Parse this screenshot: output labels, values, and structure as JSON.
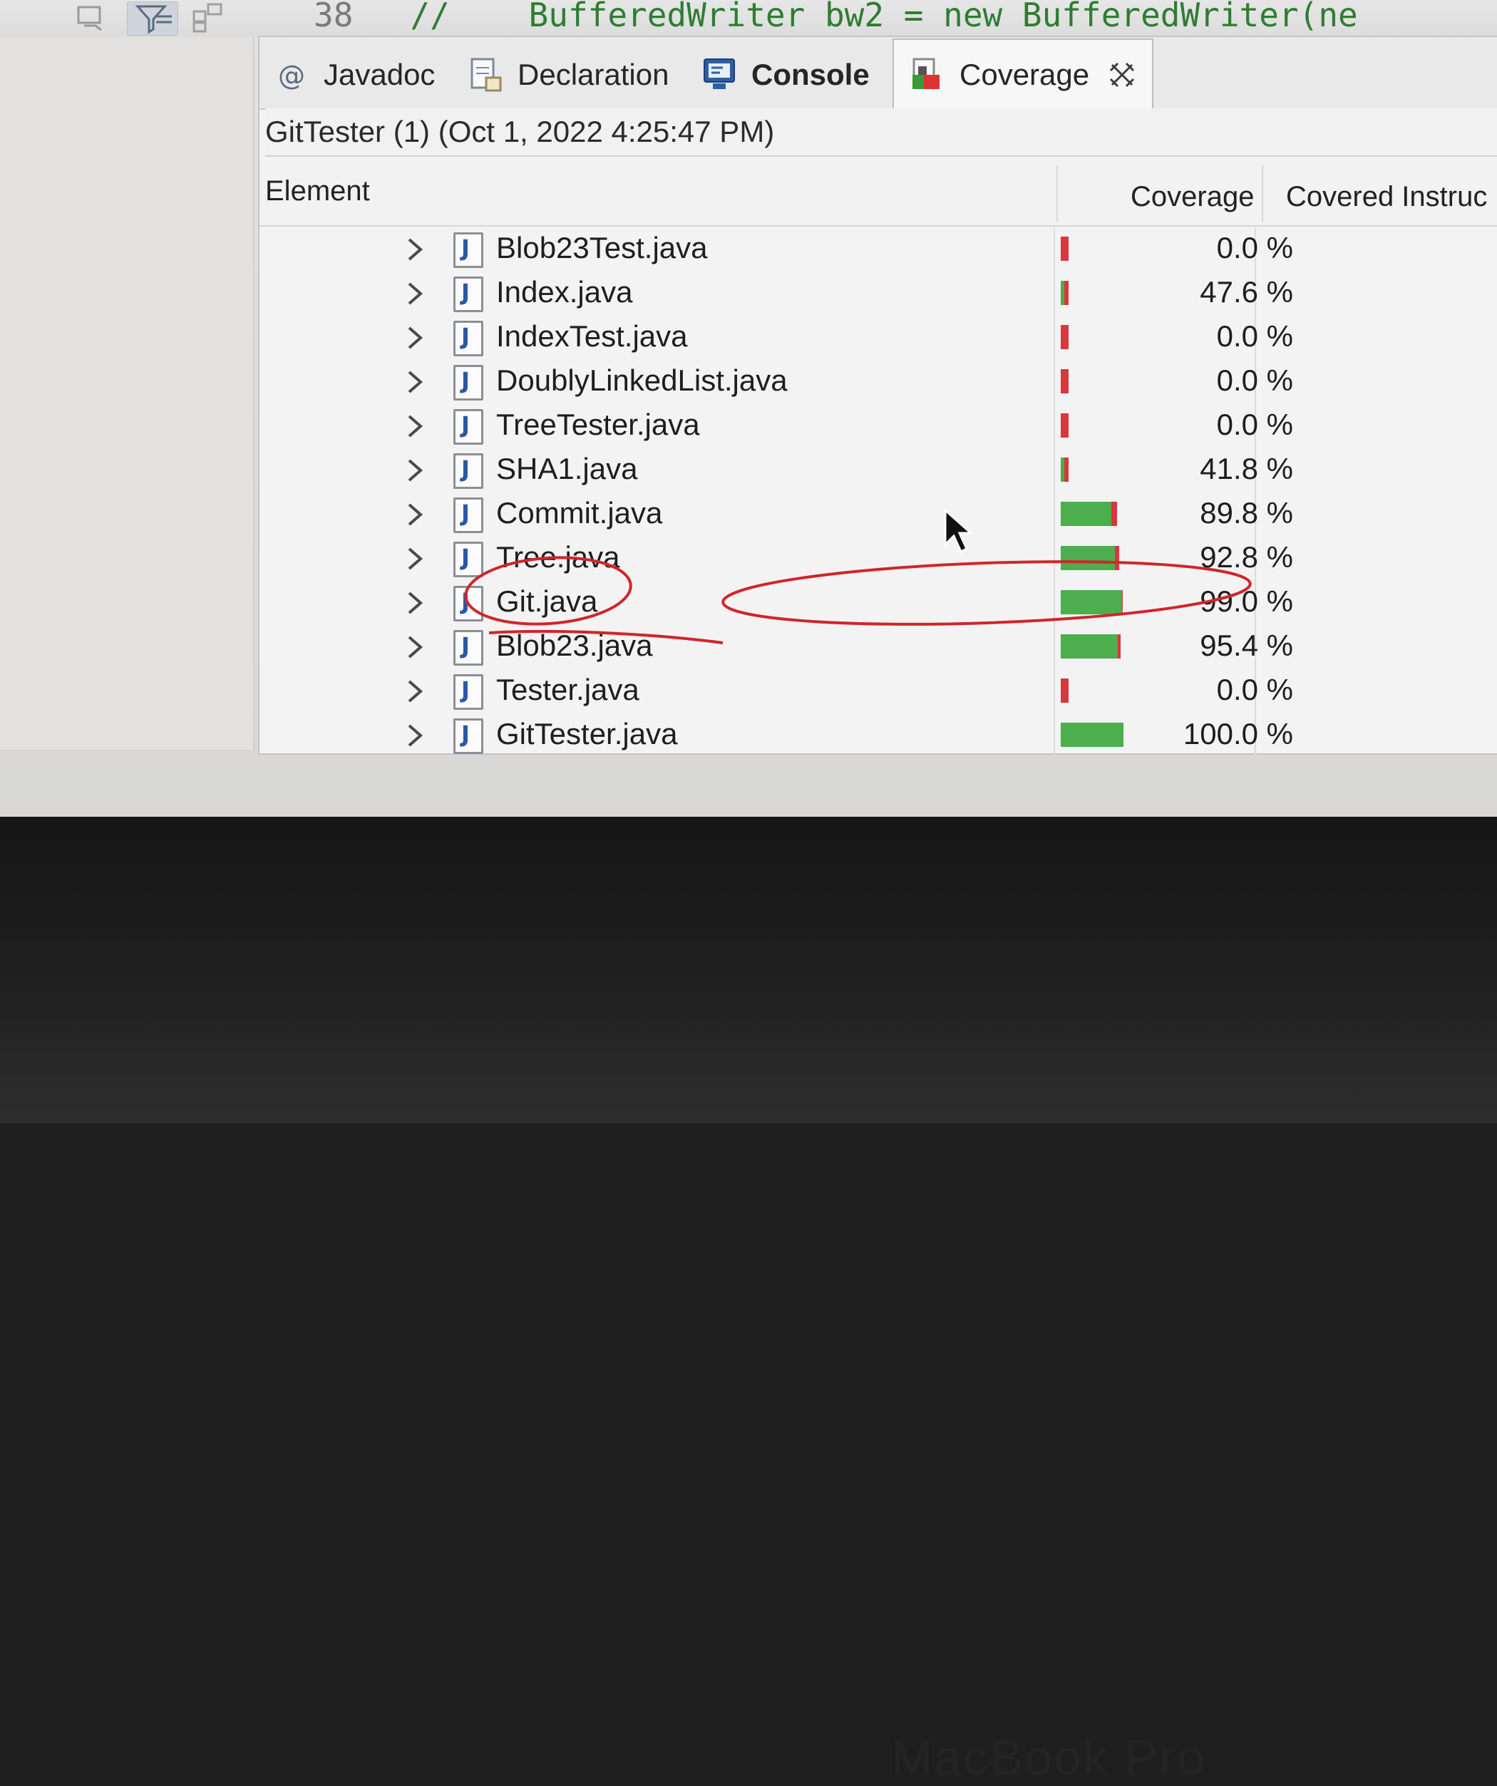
{
  "toolbar": {
    "line_number": "38",
    "code_text": "  //    BufferedWriter bw2 = new BufferedWriter(ne"
  },
  "tabs": [
    {
      "label": "Javadoc",
      "icon": "at-icon"
    },
    {
      "label": "Declaration",
      "icon": "declaration-icon"
    },
    {
      "label": "Console",
      "icon": "console-icon"
    },
    {
      "label": "Coverage",
      "icon": "coverage-icon",
      "close_icon": "close-icon"
    }
  ],
  "session_title": "GitTester (1) (Oct 1, 2022 4:25:47 PM)",
  "table": {
    "columns": [
      "Element",
      "Coverage",
      "Covered Instruc"
    ],
    "rows": [
      {
        "name": "Blob23Test.java",
        "coverage": "0.0 %",
        "covered_fraction": 0.0
      },
      {
        "name": "Index.java",
        "coverage": "47.6 %",
        "covered_fraction": 0.476
      },
      {
        "name": "IndexTest.java",
        "coverage": "0.0 %",
        "covered_fraction": 0.0
      },
      {
        "name": "DoublyLinkedList.java",
        "coverage": "0.0 %",
        "covered_fraction": 0.0
      },
      {
        "name": "TreeTester.java",
        "coverage": "0.0 %",
        "covered_fraction": 0.0
      },
      {
        "name": "SHA1.java",
        "coverage": "41.8 %",
        "covered_fraction": 0.418
      },
      {
        "name": "Commit.java",
        "coverage": "89.8 %",
        "covered_fraction": 0.898
      },
      {
        "name": "Tree.java",
        "coverage": "92.8 %",
        "covered_fraction": 0.928
      },
      {
        "name": "Git.java",
        "coverage": "99.0 %",
        "covered_fraction": 0.99
      },
      {
        "name": "Blob23.java",
        "coverage": "95.4 %",
        "covered_fraction": 0.954
      },
      {
        "name": "Tester.java",
        "coverage": "0.0 %",
        "covered_fraction": 0.0
      },
      {
        "name": "GitTester.java",
        "coverage": "100.0 %",
        "covered_fraction": 1.0
      }
    ]
  },
  "bezel_text": "MacBook Pro",
  "colors": {
    "covered": "#4cae4c",
    "missed": "#d9363e",
    "annotation": "#d0262b"
  }
}
